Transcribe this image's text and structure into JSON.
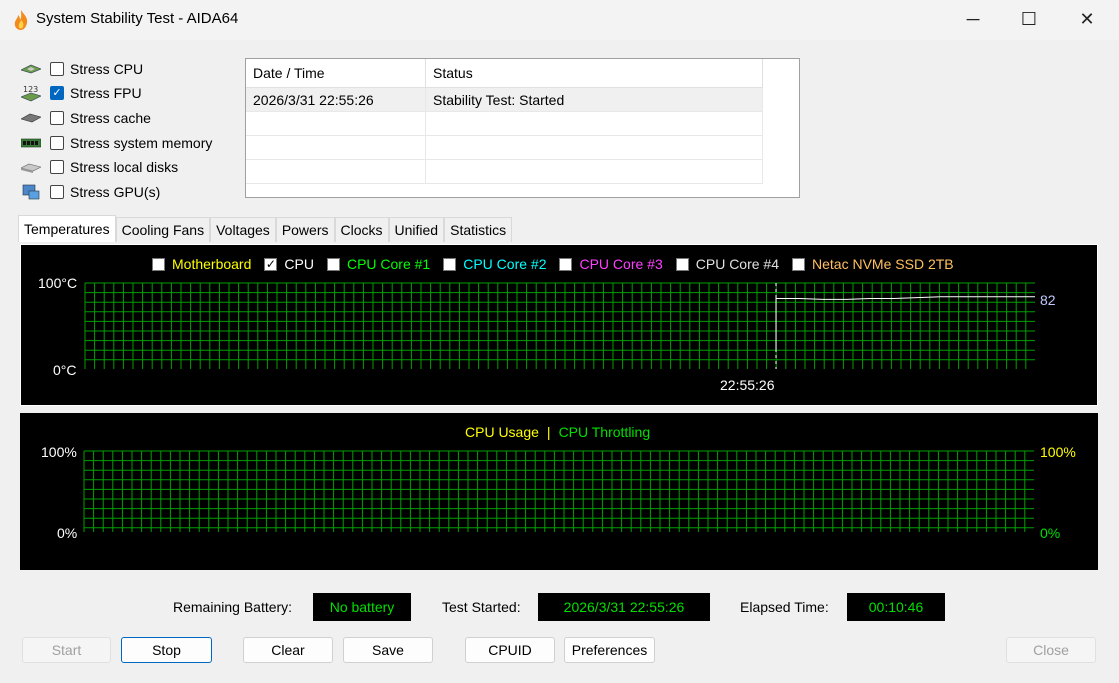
{
  "window": {
    "title": "System Stability Test - AIDA64",
    "min_glyph": "─",
    "max_glyph": "☐",
    "close_glyph": "✕"
  },
  "stress_options": [
    {
      "label": "Stress CPU",
      "checked": false,
      "icon": "cpu-chip-icon"
    },
    {
      "label": "Stress FPU",
      "checked": true,
      "icon": "fpu-numbers-icon"
    },
    {
      "label": "Stress cache",
      "checked": false,
      "icon": "cache-chip-icon"
    },
    {
      "label": "Stress system memory",
      "checked": false,
      "icon": "memory-module-icon"
    },
    {
      "label": "Stress local disks",
      "checked": false,
      "icon": "disk-drive-icon"
    },
    {
      "label": "Stress GPU(s)",
      "checked": false,
      "icon": "gpu-card-icon"
    }
  ],
  "log": {
    "headers": [
      "Date / Time",
      "Status"
    ],
    "rows": [
      [
        "2026/3/31 22:55:26",
        "Stability Test: Started"
      ],
      [
        "",
        ""
      ],
      [
        "",
        ""
      ],
      [
        "",
        ""
      ]
    ]
  },
  "tabs": [
    "Temperatures",
    "Cooling Fans",
    "Voltages",
    "Powers",
    "Clocks",
    "Unified",
    "Statistics"
  ],
  "active_tab": 0,
  "temp_graph": {
    "legend": [
      {
        "label": "Motherboard",
        "checked": false,
        "color": "#ffff00"
      },
      {
        "label": "CPU",
        "checked": true,
        "color": "#ffffff"
      },
      {
        "label": "CPU Core #1",
        "checked": false,
        "color": "#00ff00"
      },
      {
        "label": "CPU Core #2",
        "checked": false,
        "color": "#00ffff"
      },
      {
        "label": "CPU Core #3",
        "checked": false,
        "color": "#ff40ff"
      },
      {
        "label": "CPU Core #4",
        "checked": false,
        "color": "#e0e0e0"
      },
      {
        "label": "Netac NVMe SSD 2TB",
        "checked": false,
        "color": "#ffc060"
      }
    ],
    "y_max_label": "100°C",
    "y_min_label": "0°C",
    "time_marker": "22:55:26",
    "current_value": "82",
    "ylim": [
      0,
      100
    ],
    "cpu_series": [
      82,
      82,
      81,
      81,
      82,
      82,
      83,
      84,
      84,
      84,
      84,
      84
    ]
  },
  "usage_graph": {
    "title_usage": "CPU Usage",
    "separator": "|",
    "title_throttle": "CPU Throttling",
    "usage_color": "#ffff00",
    "throttle_color": "#00e000",
    "y_max_left": "100%",
    "y_min_left": "0%",
    "y_max_right": "100%",
    "y_min_right": "0%"
  },
  "status": {
    "battery_label": "Remaining Battery:",
    "battery_value": "No battery",
    "started_label": "Test Started:",
    "started_value": "2026/3/31 22:55:26",
    "elapsed_label": "Elapsed Time:",
    "elapsed_value": "00:10:46"
  },
  "buttons": {
    "start": "Start",
    "stop": "Stop",
    "clear": "Clear",
    "save": "Save",
    "cpuid": "CPUID",
    "preferences": "Preferences",
    "close": "Close"
  },
  "colors": {
    "grid": "#00a000",
    "panel_bg": "#000000",
    "accent": "#0067c0"
  }
}
